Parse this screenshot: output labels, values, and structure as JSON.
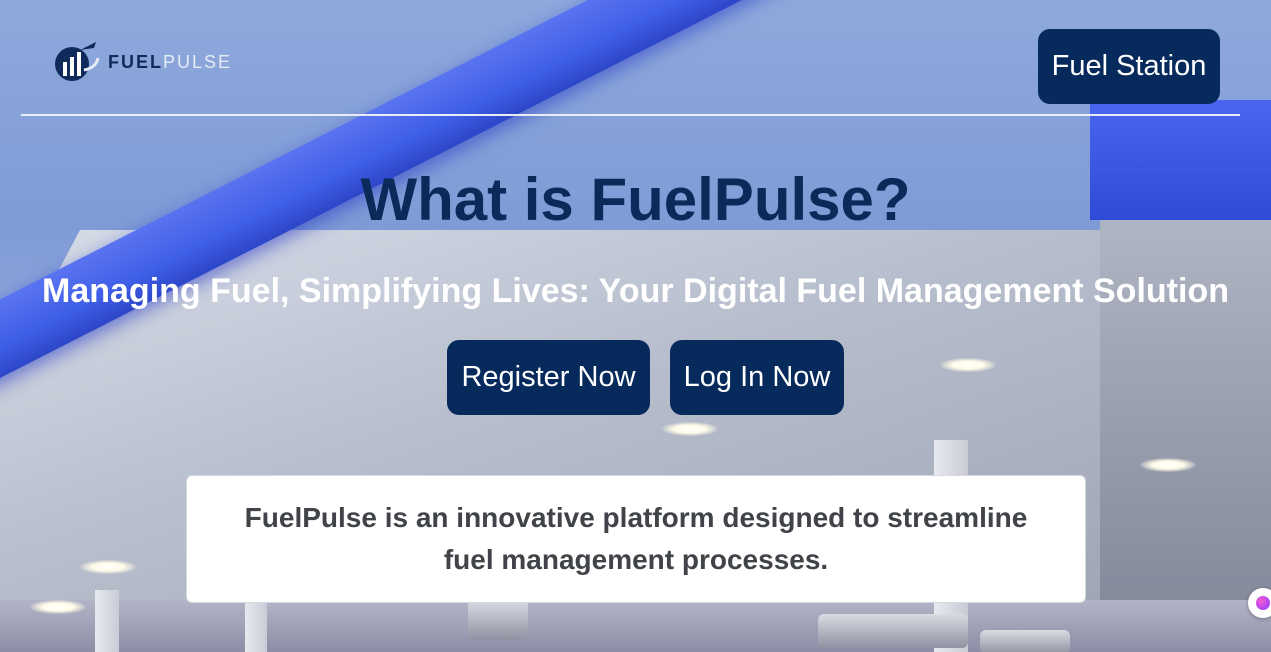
{
  "header": {
    "logo": {
      "icon": "fuel-gauge-logo-icon",
      "text_primary": "FUEL",
      "text_secondary": "PULSE"
    },
    "station_button_label": "Fuel Station"
  },
  "hero": {
    "title": "What is FuelPulse?",
    "subtitle": "Managing Fuel, Simplifying Lives: Your Digital Fuel Management Solution",
    "register_label": "Register Now",
    "login_label": "Log In Now",
    "description": "FuelPulse is an innovative platform designed to streamline fuel management processes."
  },
  "widget": {
    "icon": "assistant-bubble-icon"
  },
  "colors": {
    "primary_button": "#062a5b",
    "title": "#0a2a5a",
    "subtitle": "#ffffff",
    "card_text": "#404347"
  }
}
